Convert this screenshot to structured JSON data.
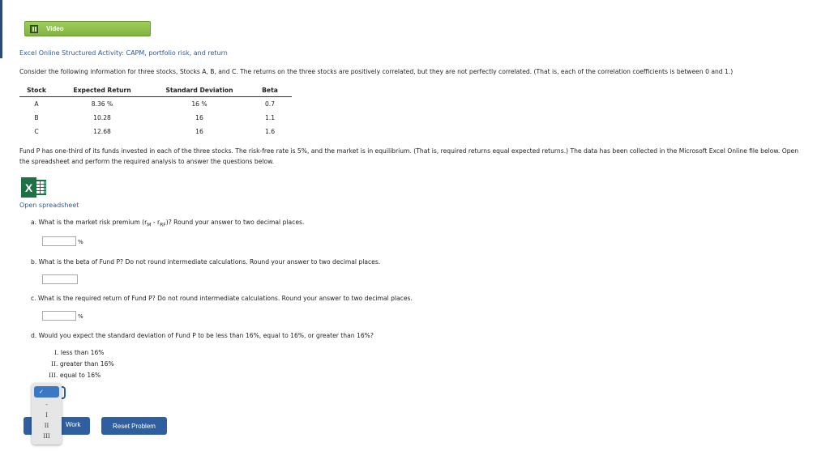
{
  "video": {
    "label": "Video"
  },
  "activity_title": "Excel Online Structured Activity: CAPM, portfolio risk, and return",
  "intro": "Consider the following information for three stocks, Stocks A, B, and C. The returns on the three stocks are positively correlated, but they are not perfectly correlated. (That is, each of the correlation coefficients is between 0 and 1.)",
  "table": {
    "headers": [
      "Stock",
      "Expected Return",
      "Standard Deviation",
      "Beta"
    ],
    "rows": [
      [
        "A",
        "8.36 %",
        "16 %",
        "0.7"
      ],
      [
        "B",
        "10.28",
        "16",
        "1.1"
      ],
      [
        "C",
        "12.68",
        "16",
        "1.6"
      ]
    ]
  },
  "fund_text": "Fund P has one-third of its funds invested in each of the three stocks. The risk-free rate is 5%, and the market is in equilibrium. (That is, required returns equal expected returns.) The data has been collected in the Microsoft Excel Online file below. Open the spreadsheet and perform the required analysis to answer the questions below.",
  "excel_icon_letter": "X",
  "open_spreadsheet": "Open spreadsheet",
  "questions": {
    "a": {
      "prefix": "a.  What is the market risk premium (r",
      "sub1": "M",
      "mid": " - r",
      "sub2": "RF",
      "suffix": ")? Round your answer to two decimal places.",
      "value": "",
      "unit": "%"
    },
    "b": {
      "text": "b.  What is the beta of Fund P? Do not round intermediate calculations. Round your answer to two decimal places.",
      "value": ""
    },
    "c": {
      "text": "c.  What is the required return of Fund P? Do not round intermediate calculations. Round your answer to two decimal places.",
      "value": "",
      "unit": "%"
    },
    "d": {
      "text": "d.  Would you expect the standard deviation of Fund P to be less than 16%, equal to 16%, or greater than 16%?"
    }
  },
  "options": [
    {
      "num": "I.",
      "text": "less than 16%"
    },
    {
      "num": "II.",
      "text": "greater than 16%"
    },
    {
      "num": "III.",
      "text": "equal to 16%"
    }
  ],
  "dropdown": {
    "selected": "✓",
    "items": [
      "-",
      "I",
      "II",
      "III"
    ]
  },
  "buttons": {
    "save_work": "Work",
    "reset": "Reset Problem"
  },
  "colors": {
    "accent": "#2f5f9e",
    "link": "#2a5c9e",
    "video_green": "#8cc04a",
    "excel_green": "#1e7145"
  }
}
